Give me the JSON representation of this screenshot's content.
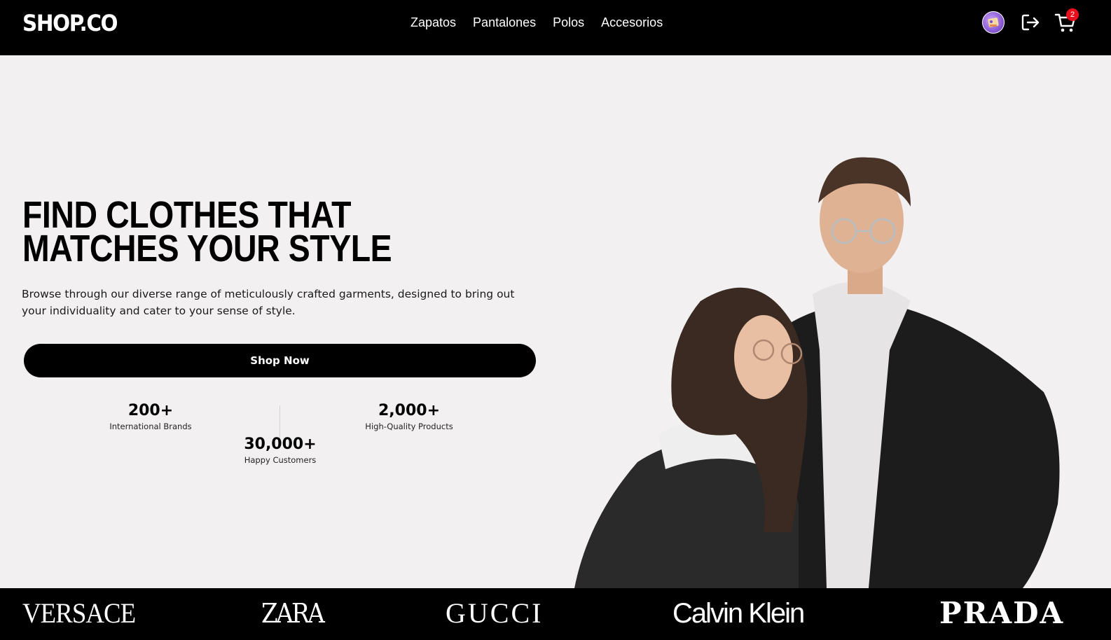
{
  "header": {
    "logo": "SHOP.CO",
    "nav": [
      "Zapatos",
      "Pantalones",
      "Polos",
      "Accesorios"
    ],
    "cart_count": "2"
  },
  "hero": {
    "title": "FIND CLOTHES THAT MATCHES YOUR STYLE",
    "description": "Browse through our diverse range of meticulously crafted garments, designed to bring out your individuality and cater to your sense of style.",
    "cta_label": "Shop Now",
    "stats": [
      {
        "value": "200+",
        "label": "International Brands"
      },
      {
        "value": "2,000+",
        "label": "High-Quality Products"
      },
      {
        "value": "30,000+",
        "label": "Happy Customers"
      }
    ]
  },
  "brands": [
    "VERSACE",
    "ZARA",
    "GUCCI",
    "Calvin Klein",
    "PRADA"
  ],
  "icons": {
    "avatar": "user-avatar-icon",
    "logout": "logout-icon",
    "cart": "shopping-cart-icon"
  },
  "colors": {
    "header_bg": "#000000",
    "page_bg": "#f2f0f1",
    "badge": "#e8101d"
  }
}
